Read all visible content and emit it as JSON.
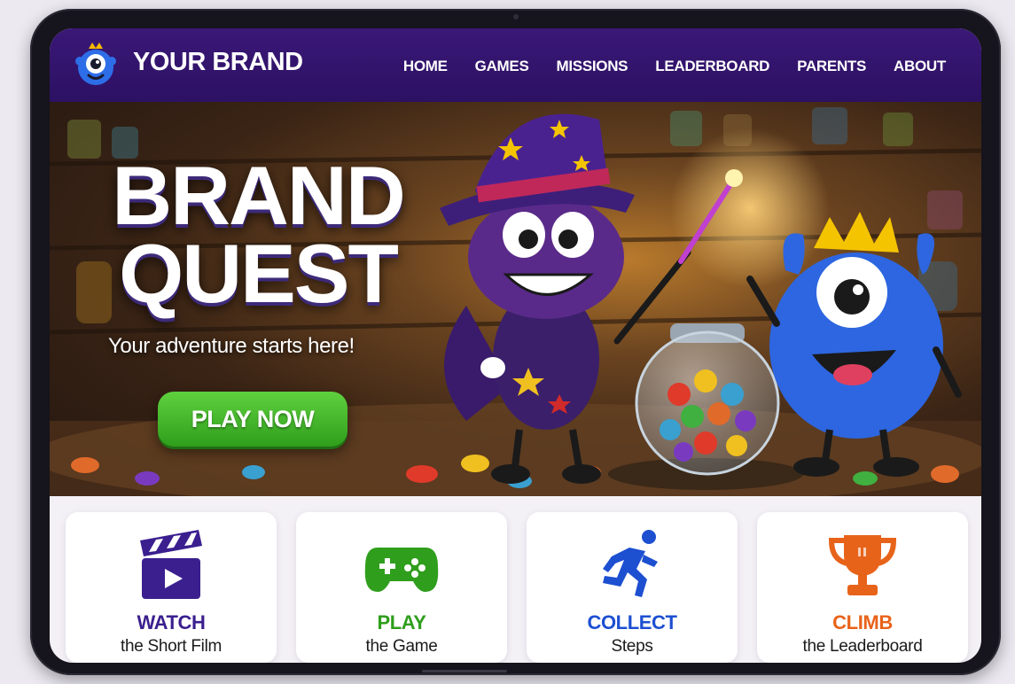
{
  "nav": {
    "brand": "YOUR BRAND",
    "logo_icon": "cyclops-monster-logo-icon",
    "links": [
      "HOME",
      "GAMES",
      "MISSIONS",
      "LEADERBOARD",
      "PARENTS",
      "ABOUT"
    ]
  },
  "hero": {
    "title_line1": "BRAND",
    "title_line2": "QUEST",
    "subtitle": "Your adventure starts here!",
    "cta_label": "PLAY NOW"
  },
  "cards": [
    {
      "title": "WATCH",
      "subtitle": "the Short Film",
      "icon": "clapperboard-icon",
      "color": "#3b1f8f"
    },
    {
      "title": "PLAY",
      "subtitle": "the Game",
      "icon": "gamepad-icon",
      "color": "#2f9e1c"
    },
    {
      "title": "COLLECT",
      "subtitle": "Steps",
      "icon": "running-person-icon",
      "color": "#1d4fd1"
    },
    {
      "title": "CLIMB",
      "subtitle": "the Leaderboard",
      "icon": "trophy-icon",
      "color": "#e8631a"
    }
  ],
  "colors": {
    "nav_bg": "#2c1163",
    "cta_green": "#2f9e1c"
  }
}
